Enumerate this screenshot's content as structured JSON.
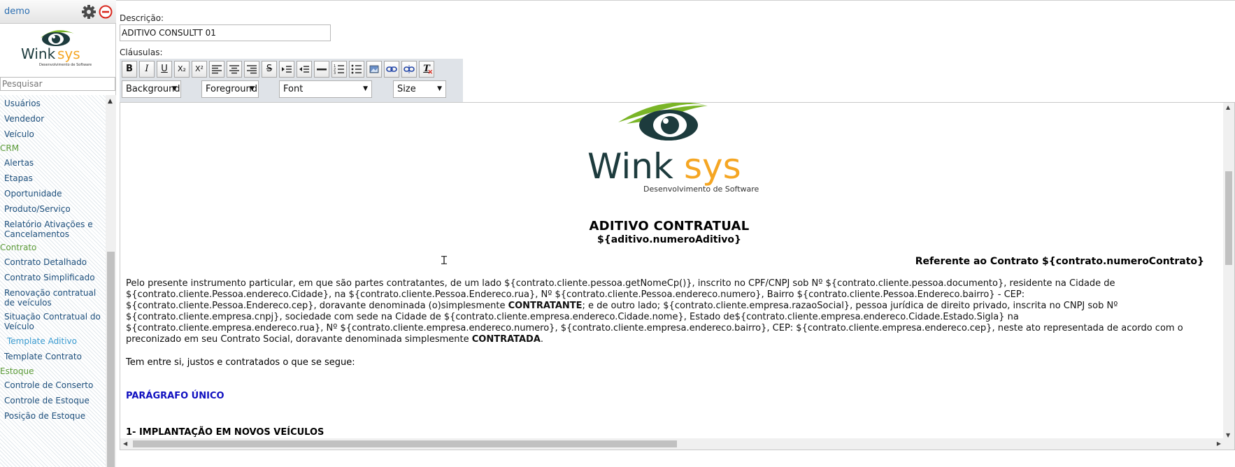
{
  "sidebar": {
    "user": "demo",
    "search_placeholder": "Pesquisar",
    "items": [
      {
        "label": "Usuários",
        "type": "item"
      },
      {
        "label": "Vendedor",
        "type": "item"
      },
      {
        "label": "Veículo",
        "type": "item"
      },
      {
        "label": "CRM",
        "type": "group"
      },
      {
        "label": "Alertas",
        "type": "item"
      },
      {
        "label": "Etapas",
        "type": "item"
      },
      {
        "label": "Oportunidade",
        "type": "item"
      },
      {
        "label": "Produto/Serviço",
        "type": "item"
      },
      {
        "label": "Relatório Ativações e Cancelamentos",
        "type": "item"
      },
      {
        "label": "Contrato",
        "type": "group"
      },
      {
        "label": "Contrato Detalhado",
        "type": "item"
      },
      {
        "label": "Contrato Simplificado",
        "type": "item"
      },
      {
        "label": "Renovação contratual de veículos",
        "type": "item"
      },
      {
        "label": "Situação Contratual do Veículo",
        "type": "item"
      },
      {
        "label": "Template Aditivo",
        "type": "item",
        "active": true
      },
      {
        "label": "Template Contrato",
        "type": "item"
      },
      {
        "label": "Estoque",
        "type": "group"
      },
      {
        "label": "Controle de Conserto",
        "type": "item"
      },
      {
        "label": "Controle de Estoque",
        "type": "item"
      },
      {
        "label": "Posição de Estoque",
        "type": "item"
      }
    ],
    "logo_text": "Winksys",
    "logo_tagline": "Desenvolvimento de Software"
  },
  "form": {
    "descricao_label": "Descrição:",
    "descricao_value": "ADITIVO CONSULTT 01",
    "clausulas_label": "Cláusulas:"
  },
  "toolbar": {
    "buttons": [
      {
        "name": "bold-button",
        "glyph": "B"
      },
      {
        "name": "italic-button",
        "glyph": "I"
      },
      {
        "name": "underline-button",
        "glyph": "U"
      },
      {
        "name": "subscript-button",
        "glyph": "X₂"
      },
      {
        "name": "superscript-button",
        "glyph": "X²"
      },
      {
        "name": "align-left-button",
        "glyph": ""
      },
      {
        "name": "align-center-button",
        "glyph": ""
      },
      {
        "name": "align-right-button",
        "glyph": ""
      },
      {
        "name": "strikethrough-button",
        "glyph": "S"
      },
      {
        "name": "indent-button",
        "glyph": ""
      },
      {
        "name": "outdent-button",
        "glyph": ""
      },
      {
        "name": "horizontal-rule-button",
        "glyph": ""
      },
      {
        "name": "ordered-list-button",
        "glyph": ""
      },
      {
        "name": "unordered-list-button",
        "glyph": ""
      },
      {
        "name": "insert-image-button",
        "glyph": ""
      },
      {
        "name": "insert-link-button",
        "glyph": ""
      },
      {
        "name": "remove-link-button",
        "glyph": ""
      },
      {
        "name": "clear-format-button",
        "glyph": "T"
      }
    ],
    "background_label": "Background",
    "foreground_label": "Foreground",
    "font_label": "Font",
    "size_label": "Size"
  },
  "document": {
    "logo_text_dark": "Wink",
    "logo_text_accent": "sys",
    "logo_tagline": "Desenvolvimento de Software",
    "title": "ADITIVO CONTRATUAL",
    "subtitle": "${aditivo.numeroAditivo}",
    "reference": "Referente ao Contrato ${contrato.numeroContrato}",
    "intro_before_contratante": "Pelo presente instrumento particular, em que são partes contratantes, de um lado ${contrato.cliente.pessoa.getNomeCp()}, inscrito no CPF/CNPJ sob Nº ${contrato.cliente.pessoa.documento}, residente na Cidade de ${contrato.cliente.Pessoa.endereco.Cidade}, na  ${contrato.cliente.Pessoa.Endereco.rua}, Nº ${contrato.cliente.Pessoa.endereco.numero}, Bairro ${contrato.cliente.Pessoa.Endereco.bairro} - CEP: ${contrato.cliente.Pessoa.Endereco.cep}, doravante denominada (o)simplesmente ",
    "contratante": "CONTRATANTE",
    "intro_middle": "; e de outro lado; ${contrato.cliente.empresa.razaoSocial}, pessoa jurídica de direito privado, inscrita no CNPJ sob Nº ${contrato.cliente.empresa.cnpj}, sociedade com sede na Cidade de ${contrato.cliente.empresa.endereco.Cidade.nome}, Estado de${contrato.cliente.empresa.endereco.Cidade.Estado.Sigla} na ${contrato.cliente.empresa.endereco.rua}, Nº ${contrato.cliente.empresa.endereco.numero}, ${contrato.cliente.empresa.endereco.bairro}, CEP: ${contrato.cliente.empresa.endereco.cep}, neste ato representada de acordo com o preconizado em seu Contrato Social, doravante denominada simplesmente ",
    "contratada": "CONTRATADA",
    "intro_end": ".",
    "agreed": "Tem entre si, justos e contratados o que se segue:",
    "paragraph_heading": "PARÁGRAFO ÚNICO",
    "section_heading": "1- IMPLANTAÇÃO EM NOVOS VEÍCULOS"
  },
  "colors": {
    "nav_link": "#1d4f7c",
    "nav_group": "#5a9a36",
    "nav_active": "#3a9bd0",
    "logo_green": "#7ab527",
    "logo_dark": "#1d3b3d",
    "logo_orange": "#f5a623",
    "paragraph_blue": "#1010c0"
  }
}
